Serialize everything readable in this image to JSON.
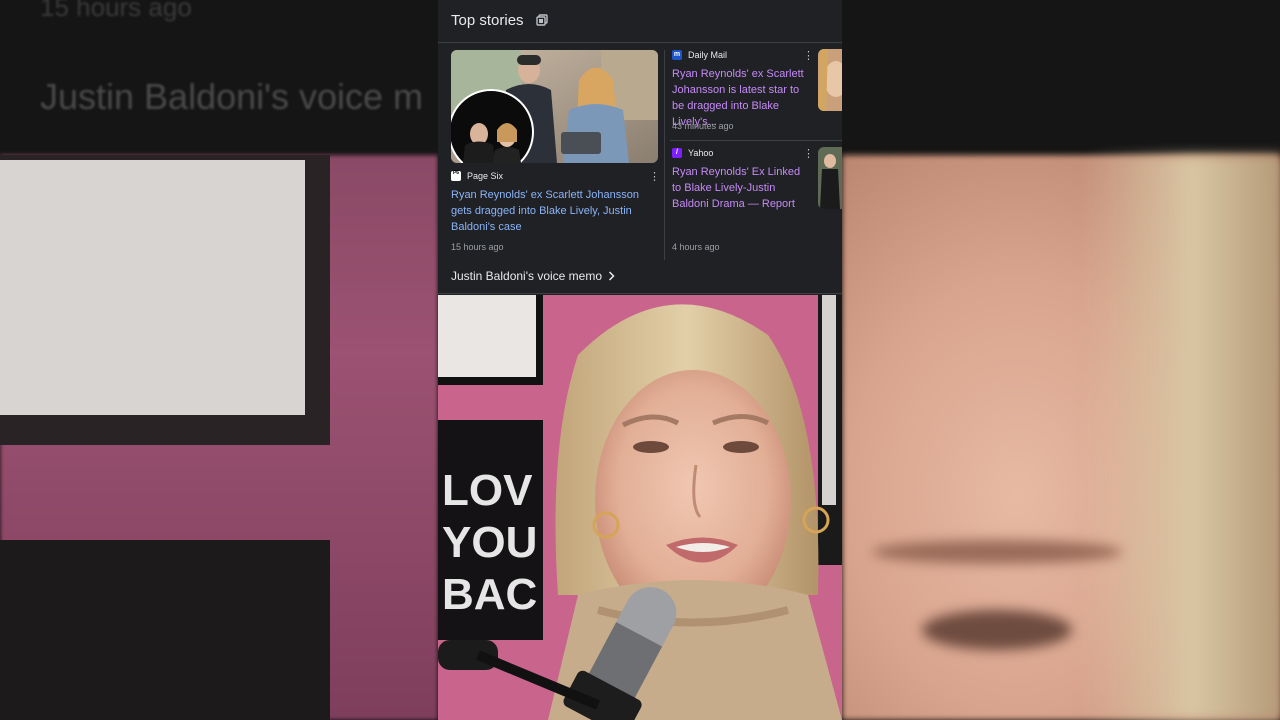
{
  "backdrop": {
    "time": "15 hours ago",
    "heading": "Justin Baldoni's voice m"
  },
  "top_stories": {
    "title": "Top stories",
    "header_icon": "stack-icon",
    "main": {
      "source": "Page Six",
      "source_logo": "Page Six",
      "headline": "Ryan Reynolds' ex Scarlett Johansson gets dragged into Blake Lively, Justin Baldoni's case",
      "time": "15 hours ago"
    },
    "side": [
      {
        "source": "Daily Mail",
        "logo_letter": "m",
        "logo_color": "#1a56c9",
        "headline": "Ryan Reynolds' ex Scarlett Johansson is latest star to be dragged into Blake Lively's...",
        "time": "43 minutes ago"
      },
      {
        "source": "Yahoo",
        "logo_letter": "/",
        "logo_color": "#7e1fff",
        "headline": "Ryan Reynolds' Ex Linked to Blake Lively-Justin Baldoni Drama — Report",
        "time": "4 hours ago"
      }
    ],
    "more_link": "Justin Baldoni's voice memo",
    "more_icon": "chevron-right-icon"
  },
  "video_overlay": {
    "poster_text": [
      "LOVE",
      "YOU",
      "BAC"
    ]
  },
  "colors": {
    "link": "#8ab4f8",
    "visited_link": "#c58af9",
    "panel": "#202124"
  }
}
